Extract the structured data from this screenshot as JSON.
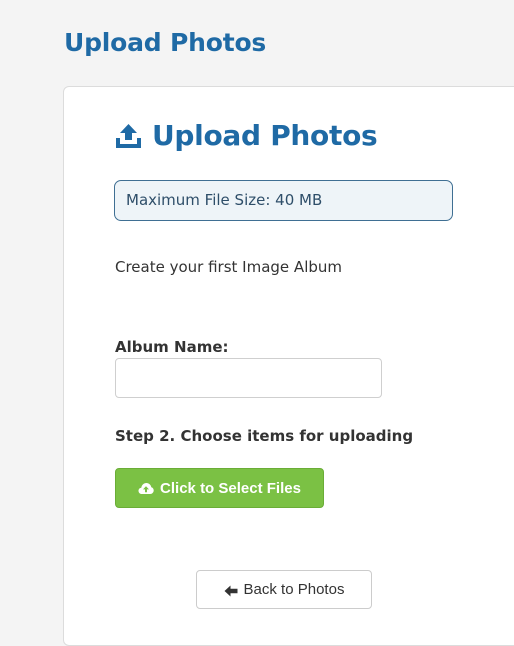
{
  "page": {
    "title": "Upload Photos"
  },
  "card": {
    "title": "Upload Photos",
    "header_icon": "upload-icon",
    "info_text": "Maximum File Size: 40 MB",
    "intro_text": "Create your first Image Album",
    "album_label": "Album Name:",
    "album_value": "",
    "step_label": "Step 2. Choose items for uploading",
    "select_files_label": "Click to Select Files",
    "select_files_icon": "cloud-upload-icon",
    "back_label": "Back to Photos",
    "back_icon": "arrow-left-icon"
  },
  "colors": {
    "heading": "#1f6aa5",
    "info_border": "#3f6f93",
    "info_bg": "#eef4f8",
    "primary_button": "#7bc144",
    "page_bg": "#f4f4f4"
  }
}
